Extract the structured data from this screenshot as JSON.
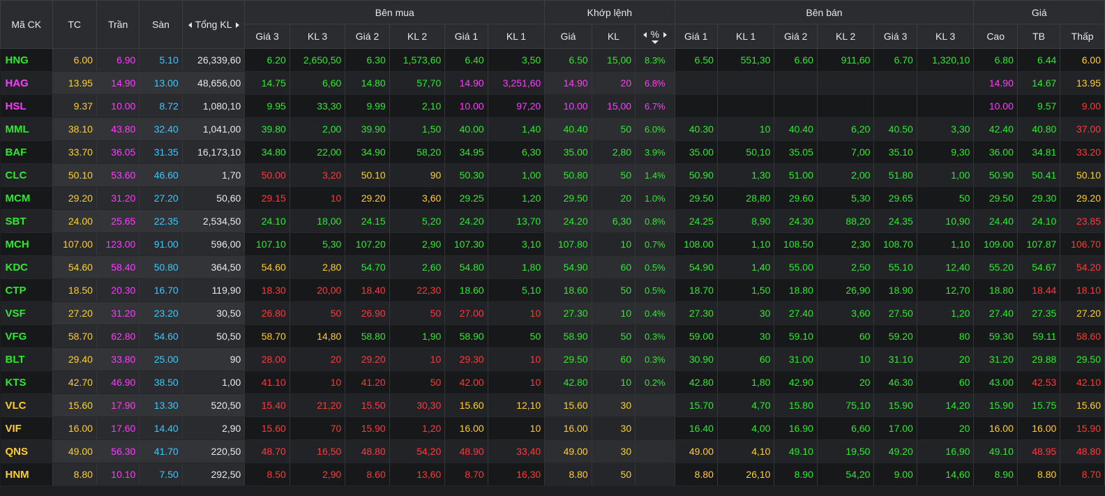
{
  "colors": {
    "up": "#2eea2e",
    "down": "#ff3a3a",
    "ref": "#ffd02a",
    "ceil": "#ff3cff",
    "floor": "#39c9ff",
    "text": "#e8e8e8"
  },
  "icons": {
    "sort_left": "caret-left-icon",
    "sort_right": "caret-right-icon",
    "sort_down": "caret-down-icon"
  },
  "header": {
    "symbol": "Mã CK",
    "ref": "TC",
    "ceil": "Trần",
    "floor": "Sàn",
    "total_volume": "Tổng KL",
    "buy_side": "Bên mua",
    "matched": "Khớp lệnh",
    "sell_side": "Bên bán",
    "price_group": "Giá",
    "buy_cols": [
      "Giá 3",
      "KL 3",
      "Giá 2",
      "KL 2",
      "Giá 1",
      "KL 1"
    ],
    "match_cols": [
      "Giá",
      "KL",
      "%"
    ],
    "sell_cols": [
      "Giá 1",
      "KL 1",
      "Giá 2",
      "KL 2",
      "Giá 3",
      "KL 3"
    ],
    "price_cols": [
      "Cao",
      "TB",
      "Thấp"
    ]
  },
  "rows": [
    {
      "sym": "HNG",
      "tc": "6.00",
      "tran": "6.90",
      "san": "5.10",
      "tkl": "26,339,60",
      "b3p": "6.20",
      "b3v": "2,650,50",
      "b2p": "6.30",
      "b2v": "1,573,60",
      "b1p": "6.40",
      "b1v": "3,50",
      "mp": "6.50",
      "mv": "15,00",
      "pct": "8.3%",
      "s1p": "6.50",
      "s1v": "551,30",
      "s2p": "6.60",
      "s2v": "911,60",
      "s3p": "6.70",
      "s3v": "1,320,10",
      "cao": "6.80",
      "tb": "6.44",
      "thap": "6.00"
    },
    {
      "sym": "HAG",
      "tc": "13.95",
      "tran": "14.90",
      "san": "13.00",
      "tkl": "48,656,00",
      "b3p": "14.75",
      "b3v": "6,60",
      "b2p": "14.80",
      "b2v": "57,70",
      "b1p": "14.90",
      "b1v": "3,251,60",
      "mp": "14.90",
      "mv": "20",
      "pct": "6.8%",
      "s1p": "",
      "s1v": "",
      "s2p": "",
      "s2v": "",
      "s3p": "",
      "s3v": "",
      "cao": "14.90",
      "tb": "14.67",
      "thap": "13.95"
    },
    {
      "sym": "HSL",
      "tc": "9.37",
      "tran": "10.00",
      "san": "8.72",
      "tkl": "1,080,10",
      "b3p": "9.95",
      "b3v": "33,30",
      "b2p": "9.99",
      "b2v": "2,10",
      "b1p": "10.00",
      "b1v": "97,20",
      "mp": "10.00",
      "mv": "15,00",
      "pct": "6.7%",
      "s1p": "",
      "s1v": "",
      "s2p": "",
      "s2v": "",
      "s3p": "",
      "s3v": "",
      "cao": "10.00",
      "tb": "9.57",
      "thap": "9.00"
    },
    {
      "sym": "MML",
      "tc": "38.10",
      "tran": "43.80",
      "san": "32.40",
      "tkl": "1,041,00",
      "b3p": "39.80",
      "b3v": "2,00",
      "b2p": "39.90",
      "b2v": "1,50",
      "b1p": "40.00",
      "b1v": "1,40",
      "mp": "40.40",
      "mv": "50",
      "pct": "6.0%",
      "s1p": "40.30",
      "s1v": "10",
      "s2p": "40.40",
      "s2v": "6,20",
      "s3p": "40.50",
      "s3v": "3,30",
      "cao": "42.40",
      "tb": "40.80",
      "thap": "37.00"
    },
    {
      "sym": "BAF",
      "tc": "33.70",
      "tran": "36.05",
      "san": "31.35",
      "tkl": "16,173,10",
      "b3p": "34.80",
      "b3v": "22,00",
      "b2p": "34.90",
      "b2v": "58,20",
      "b1p": "34.95",
      "b1v": "6,30",
      "mp": "35.00",
      "mv": "2,80",
      "pct": "3.9%",
      "s1p": "35.00",
      "s1v": "50,10",
      "s2p": "35.05",
      "s2v": "7,00",
      "s3p": "35.10",
      "s3v": "9,30",
      "cao": "36.00",
      "tb": "34.81",
      "thap": "33.20"
    },
    {
      "sym": "CLC",
      "tc": "50.10",
      "tran": "53.60",
      "san": "46.60",
      "tkl": "1,70",
      "b3p": "50.00",
      "b3v": "3,20",
      "b2p": "50.10",
      "b2v": "90",
      "b1p": "50.30",
      "b1v": "1,00",
      "mp": "50.80",
      "mv": "50",
      "pct": "1.4%",
      "s1p": "50.90",
      "s1v": "1,30",
      "s2p": "51.00",
      "s2v": "2,00",
      "s3p": "51.80",
      "s3v": "1,00",
      "cao": "50.90",
      "tb": "50.41",
      "thap": "50.10"
    },
    {
      "sym": "MCM",
      "tc": "29.20",
      "tran": "31.20",
      "san": "27.20",
      "tkl": "50,60",
      "b3p": "29.15",
      "b3v": "10",
      "b2p": "29.20",
      "b2v": "3,60",
      "b1p": "29.25",
      "b1v": "1,20",
      "mp": "29.50",
      "mv": "20",
      "pct": "1.0%",
      "s1p": "29.50",
      "s1v": "28,80",
      "s2p": "29.60",
      "s2v": "5,30",
      "s3p": "29.65",
      "s3v": "50",
      "cao": "29.50",
      "tb": "29.30",
      "thap": "29.20"
    },
    {
      "sym": "SBT",
      "tc": "24.00",
      "tran": "25.65",
      "san": "22.35",
      "tkl": "2,534,50",
      "b3p": "24.10",
      "b3v": "18,00",
      "b2p": "24.15",
      "b2v": "5,20",
      "b1p": "24.20",
      "b1v": "13,70",
      "mp": "24.20",
      "mv": "6,30",
      "pct": "0.8%",
      "s1p": "24.25",
      "s1v": "8,90",
      "s2p": "24.30",
      "s2v": "88,20",
      "s3p": "24.35",
      "s3v": "10,90",
      "cao": "24.40",
      "tb": "24.10",
      "thap": "23.85"
    },
    {
      "sym": "MCH",
      "tc": "107.00",
      "tran": "123.00",
      "san": "91.00",
      "tkl": "596,00",
      "b3p": "107.10",
      "b3v": "5,30",
      "b2p": "107.20",
      "b2v": "2,90",
      "b1p": "107.30",
      "b1v": "3,10",
      "mp": "107.80",
      "mv": "10",
      "pct": "0.7%",
      "s1p": "108.00",
      "s1v": "1,10",
      "s2p": "108.50",
      "s2v": "2,30",
      "s3p": "108.70",
      "s3v": "1,10",
      "cao": "109.00",
      "tb": "107.87",
      "thap": "106.70"
    },
    {
      "sym": "KDC",
      "tc": "54.60",
      "tran": "58.40",
      "san": "50.80",
      "tkl": "364,50",
      "b3p": "54.60",
      "b3v": "2,80",
      "b2p": "54.70",
      "b2v": "2,60",
      "b1p": "54.80",
      "b1v": "1,80",
      "mp": "54.90",
      "mv": "60",
      "pct": "0.5%",
      "s1p": "54.90",
      "s1v": "1,40",
      "s2p": "55.00",
      "s2v": "2,50",
      "s3p": "55.10",
      "s3v": "12,40",
      "cao": "55.20",
      "tb": "54.67",
      "thap": "54.20"
    },
    {
      "sym": "CTP",
      "tc": "18.50",
      "tran": "20.30",
      "san": "16.70",
      "tkl": "119,90",
      "b3p": "18.30",
      "b3v": "20,00",
      "b2p": "18.40",
      "b2v": "22,30",
      "b1p": "18.60",
      "b1v": "5,10",
      "mp": "18.60",
      "mv": "50",
      "pct": "0.5%",
      "s1p": "18.70",
      "s1v": "1,50",
      "s2p": "18.80",
      "s2v": "26,90",
      "s3p": "18.90",
      "s3v": "12,70",
      "cao": "18.80",
      "tb": "18.44",
      "thap": "18.10"
    },
    {
      "sym": "VSF",
      "tc": "27.20",
      "tran": "31.20",
      "san": "23.20",
      "tkl": "30,50",
      "b3p": "26.80",
      "b3v": "50",
      "b2p": "26.90",
      "b2v": "50",
      "b1p": "27.00",
      "b1v": "10",
      "mp": "27.30",
      "mv": "10",
      "pct": "0.4%",
      "s1p": "27.30",
      "s1v": "30",
      "s2p": "27.40",
      "s2v": "3,60",
      "s3p": "27.50",
      "s3v": "1,20",
      "cao": "27.40",
      "tb": "27.35",
      "thap": "27.20"
    },
    {
      "sym": "VFG",
      "tc": "58.70",
      "tran": "62.80",
      "san": "54.60",
      "tkl": "50,50",
      "b3p": "58.70",
      "b3v": "14,80",
      "b2p": "58.80",
      "b2v": "1,90",
      "b1p": "58.90",
      "b1v": "50",
      "mp": "58.90",
      "mv": "50",
      "pct": "0.3%",
      "s1p": "59.00",
      "s1v": "30",
      "s2p": "59.10",
      "s2v": "60",
      "s3p": "59.20",
      "s3v": "80",
      "cao": "59.30",
      "tb": "59.11",
      "thap": "58.60"
    },
    {
      "sym": "BLT",
      "tc": "29.40",
      "tran": "33.80",
      "san": "25.00",
      "tkl": "90",
      "b3p": "28.00",
      "b3v": "20",
      "b2p": "29.20",
      "b2v": "10",
      "b1p": "29.30",
      "b1v": "10",
      "mp": "29.50",
      "mv": "60",
      "pct": "0.3%",
      "s1p": "30.90",
      "s1v": "60",
      "s2p": "31.00",
      "s2v": "10",
      "s3p": "31.10",
      "s3v": "20",
      "cao": "31.20",
      "tb": "29.88",
      "thap": "29.50"
    },
    {
      "sym": "KTS",
      "tc": "42.70",
      "tran": "46.90",
      "san": "38.50",
      "tkl": "1,00",
      "b3p": "41.10",
      "b3v": "10",
      "b2p": "41.20",
      "b2v": "50",
      "b1p": "42.00",
      "b1v": "10",
      "mp": "42.80",
      "mv": "10",
      "pct": "0.2%",
      "s1p": "42.80",
      "s1v": "1,80",
      "s2p": "42.90",
      "s2v": "20",
      "s3p": "46.30",
      "s3v": "60",
      "cao": "43.00",
      "tb": "42.53",
      "thap": "42.10"
    },
    {
      "sym": "VLC",
      "tc": "15.60",
      "tran": "17.90",
      "san": "13.30",
      "tkl": "520,50",
      "b3p": "15.40",
      "b3v": "21,20",
      "b2p": "15.50",
      "b2v": "30,30",
      "b1p": "15.60",
      "b1v": "12,10",
      "mp": "15.60",
      "mv": "30",
      "pct": "",
      "s1p": "15.70",
      "s1v": "4,70",
      "s2p": "15.80",
      "s2v": "75,10",
      "s3p": "15.90",
      "s3v": "14,20",
      "cao": "15.90",
      "tb": "15.75",
      "thap": "15.60"
    },
    {
      "sym": "VIF",
      "tc": "16.00",
      "tran": "17.60",
      "san": "14.40",
      "tkl": "2,90",
      "b3p": "15.60",
      "b3v": "70",
      "b2p": "15.90",
      "b2v": "1,20",
      "b1p": "16.00",
      "b1v": "10",
      "mp": "16.00",
      "mv": "30",
      "pct": "",
      "s1p": "16.40",
      "s1v": "4,00",
      "s2p": "16.90",
      "s2v": "6,60",
      "s3p": "17.00",
      "s3v": "20",
      "cao": "16.00",
      "tb": "16.00",
      "thap": "15.90"
    },
    {
      "sym": "QNS",
      "tc": "49.00",
      "tran": "56.30",
      "san": "41.70",
      "tkl": "220,50",
      "b3p": "48.70",
      "b3v": "16,50",
      "b2p": "48.80",
      "b2v": "54,20",
      "b1p": "48.90",
      "b1v": "33,40",
      "mp": "49.00",
      "mv": "30",
      "pct": "",
      "s1p": "49.00",
      "s1v": "4,10",
      "s2p": "49.10",
      "s2v": "19,50",
      "s3p": "49.20",
      "s3v": "16,90",
      "cao": "49.10",
      "tb": "48.95",
      "thap": "48.80"
    },
    {
      "sym": "HNM",
      "tc": "8.80",
      "tran": "10.10",
      "san": "7.50",
      "tkl": "292,50",
      "b3p": "8.50",
      "b3v": "2,90",
      "b2p": "8.60",
      "b2v": "13,60",
      "b1p": "8.70",
      "b1v": "16,30",
      "mp": "8.80",
      "mv": "50",
      "pct": "",
      "s1p": "8.80",
      "s1v": "26,10",
      "s2p": "8.90",
      "s2v": "54,20",
      "s3p": "9.00",
      "s3v": "14,60",
      "cao": "8.90",
      "tb": "8.80",
      "thap": "8.70"
    }
  ]
}
